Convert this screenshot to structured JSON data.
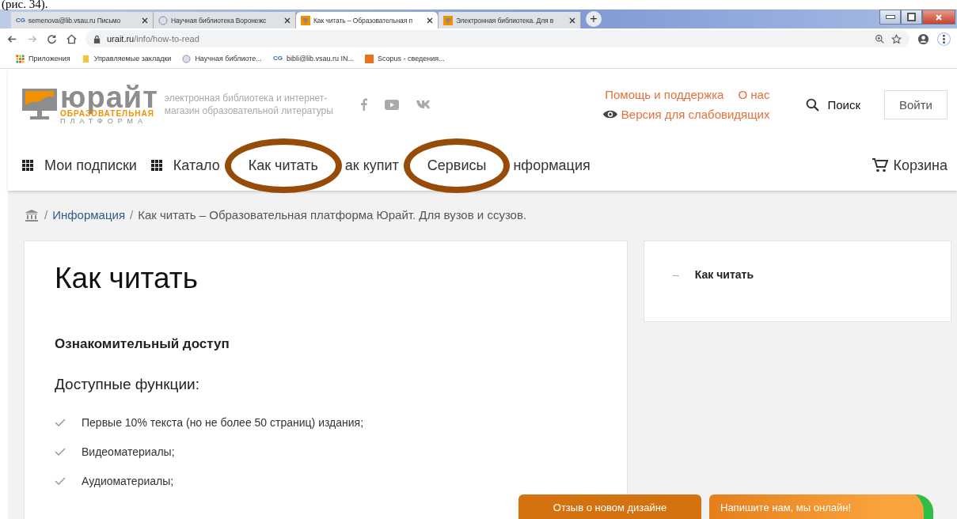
{
  "document_caption": "(рис. 34).",
  "browser": {
    "tabs": [
      {
        "title": "semenova@lib.vsau.ru Письмо",
        "kind": "mail",
        "favicon_text": "CG",
        "selected": false
      },
      {
        "title": "Научная библиотека Воронежс",
        "kind": "globe",
        "selected": false
      },
      {
        "title": "Как читать – Образовательная п",
        "kind": "site",
        "selected": true
      },
      {
        "title": "Электронная библиотека. Для в",
        "kind": "site",
        "selected": false
      }
    ],
    "new_tab": "+",
    "url_host": "urait.ru",
    "url_path": "/info/how-to-read",
    "bookmarks": [
      {
        "label": "Приложения",
        "kind": "apps"
      },
      {
        "label": "Управляемые закладки",
        "kind": "folder"
      },
      {
        "label": "Научная библиоте...",
        "kind": "globe"
      },
      {
        "label": "bibli@lib.vsau.ru IN...",
        "kind": "mail",
        "favicon_text": "CG"
      },
      {
        "label": "Scopus - сведения...",
        "kind": "scopus"
      }
    ]
  },
  "site": {
    "logo": {
      "word": "юрайт",
      "line1": "ОБРАЗОВАТЕЛЬНАЯ",
      "line2": "ПЛАТФОРМА"
    },
    "tagline": "электронная библиотека и интернет-магазин образовательной литературы",
    "top_links": [
      "Помощь и поддержка",
      "О нас"
    ],
    "low_vision": "Версия для слабовидящих",
    "search": "Поиск",
    "login": "Войти",
    "nav": [
      {
        "label": "Мои подписки",
        "kind": "grid",
        "circled": false
      },
      {
        "label": "Катало",
        "kind": "grid",
        "circled": false
      },
      {
        "label": "Как читать",
        "kind": "plain",
        "circled": true
      },
      {
        "label": "ак купит",
        "kind": "plain",
        "circled": false
      },
      {
        "label": "Сервисы",
        "kind": "plain",
        "circled": true
      },
      {
        "label": "нформация",
        "kind": "plain",
        "circled": false
      }
    ],
    "cart": "Корзина"
  },
  "breadcrumb": [
    {
      "separator": "/",
      "label": "Информация",
      "link": true
    },
    {
      "separator": "/",
      "label": "Как читать – Образовательная платформа Юрайт. Для вузов и ссузов.",
      "link": false
    }
  ],
  "article": {
    "title": "Как читать",
    "subtitle": "Ознакомительный доступ",
    "section": "Доступные функции:",
    "items": [
      "Первые 10% текста (но не более 50 страниц) издания;",
      "Видеоматериалы;",
      "Аудиоматериалы;"
    ]
  },
  "side_menu": [
    {
      "marker": "–",
      "label": "Как читать",
      "selected": true
    }
  ],
  "floating": {
    "feedback": "Отзыв о новом дизайне",
    "chat": "Напишите нам, мы онлайн!"
  }
}
